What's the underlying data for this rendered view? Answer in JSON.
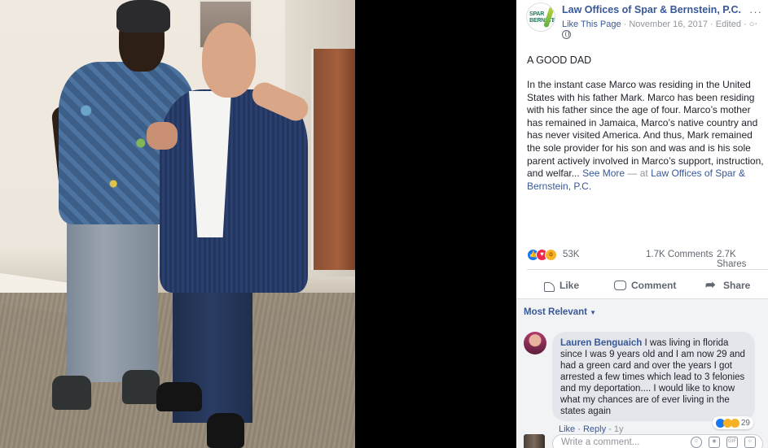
{
  "post": {
    "page_name": "Law Offices of Spar & Bernstein, P.C.",
    "like_page": "Like This Page",
    "date": "November 16, 2017",
    "edited": "Edited",
    "meta_sep": " · ",
    "logo_text_1": "SPAR",
    "logo_text_2": "BERNSTEIN",
    "title": "A GOOD DAD",
    "body": "In the instant case Marco was residing in the United States with his father Mark. Marco has been residing with his father since the age of four. Marco’s mother has remained in Jamaica, Marco’s native country and has never visited America. And thus, Mark remained the sole provider for his son and was and is his sole parent actively involved in Marco’s support, instruction, and welfar...",
    "see_more": "See More",
    "at_sep": " — at ",
    "at_page": "Law Offices of Spar & Bernstein, P.C.",
    "more_icon": "more-options-icon"
  },
  "stats": {
    "reactions": "53K",
    "comments": "1.7K Comments",
    "shares": "2.7K Shares"
  },
  "actions": {
    "like": "Like",
    "comment": "Comment",
    "share": "Share"
  },
  "comments": {
    "filter": "Most Relevant",
    "items": [
      {
        "author": "Lauren Benguaich",
        "text": "I was living in florida since I was 9 years old and I am now 29 and had a green card and over the years I got arrested a few times which lead to 3 felonies and my deportation.... I would like to know what my chances are of ever living in the states again",
        "reaction_count": "29",
        "like": "Like",
        "reply": "Reply",
        "time": "1y"
      }
    ],
    "write_placeholder": "Write a comment..."
  },
  "colors": {
    "link": "#385898",
    "meta": "#90949c",
    "like_blue": "#1877f2",
    "love_red": "#f02849",
    "wow_yellow": "#f7b125"
  }
}
